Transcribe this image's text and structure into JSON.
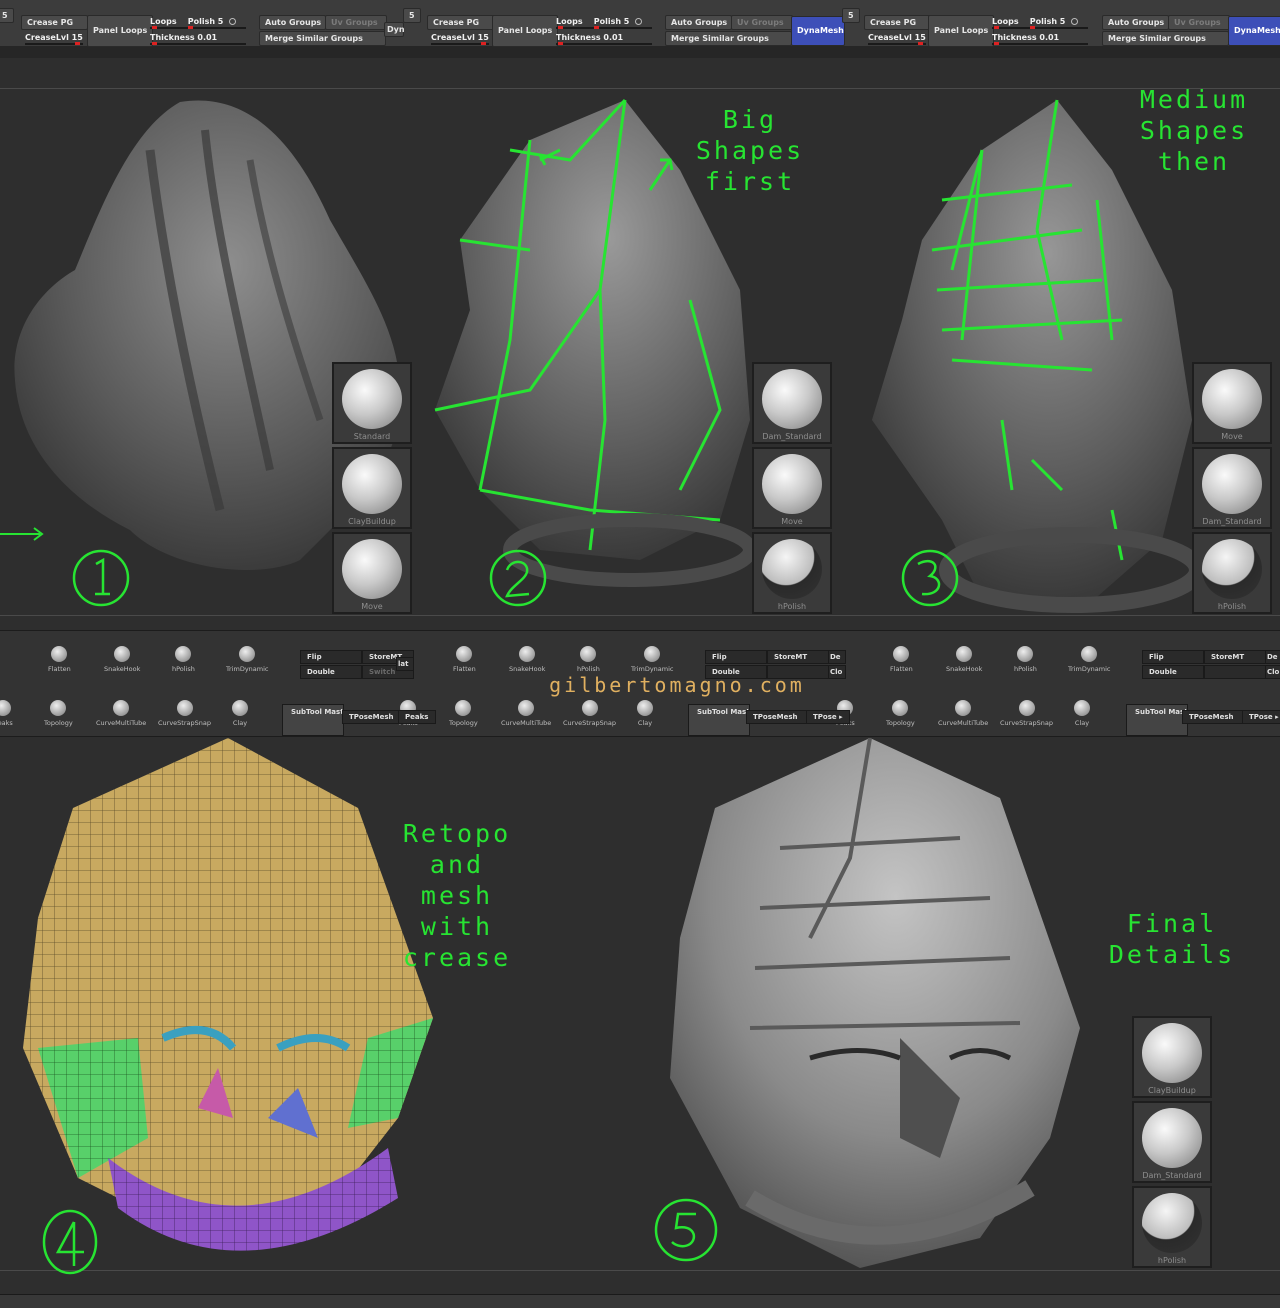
{
  "toolbar": {
    "groups": [
      {
        "crease_pg": "Crease PG",
        "crease_lvl": "CreaseLvl 15",
        "panel_loops": "Panel Loops",
        "loops": "Loops",
        "polish": "Polish 5",
        "thickness": "Thickness 0.01",
        "auto_groups": "Auto Groups",
        "uv_groups": "Uv Groups",
        "merge_similar": "Merge Similar Groups"
      }
    ],
    "fragment_5": "5",
    "fragment_dyn": "Dyn",
    "dynamesh": "DynaMesh"
  },
  "panels": {
    "step1": {
      "brushes": [
        "Standard",
        "ClayBuildup",
        "Move"
      ]
    },
    "step2": {
      "note": "Big\nShapes\nfirst",
      "brushes": [
        "Dam_Standard",
        "Move",
        "hPolish"
      ]
    },
    "step3": {
      "note": "Medium\nShapes\nthen",
      "brushes": [
        "Move",
        "Dam_Standard",
        "hPolish"
      ]
    },
    "step4": {
      "note": "Retopo\nand\nmesh\nwith\ncrease"
    },
    "step5": {
      "note": "Final\nDetails",
      "brushes": [
        "ClayBuildup",
        "Dam_Standard",
        "hPolish"
      ]
    }
  },
  "palette": {
    "row1": [
      "Flatten",
      "SnakeHook",
      "hPolish",
      "TrimDynamic"
    ],
    "row1_buttons": {
      "flip": "Flip",
      "double": "Double",
      "storemt": "StoreMT",
      "switch": "Switch"
    },
    "row2": [
      "Peaks",
      "Topology",
      "CurveMultiTube",
      "CurveStrapSnap",
      "Clay"
    ],
    "row2_buttons": {
      "subtool_master": "SubTool Master",
      "tposemesh": "TPoseMesh",
      "tpose": "TPose"
    },
    "fragments": {
      "lat": "lat",
      "de": "De",
      "clo": "Clo",
      "switch_dim": "Switch",
      "peaks_cut": "Peaks",
      "tpose_arrow": "TPose ▸"
    }
  },
  "watermark": "gilbertomagno.com",
  "colors": {
    "annotation": "#27e432",
    "dynamesh": "#3d4fb8",
    "crease_mark": "#dd2222"
  }
}
